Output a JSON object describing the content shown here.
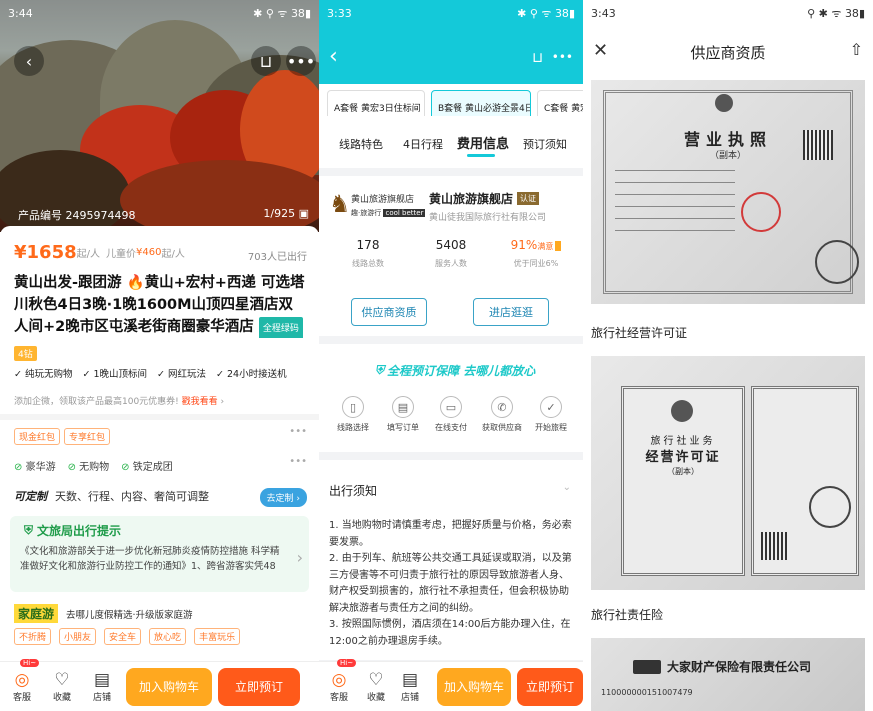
{
  "panel1": {
    "status": {
      "time": "3:44",
      "battery": "38"
    },
    "hero": {
      "product_code": "产品编号 2495974498",
      "counter": "1/925"
    },
    "price": {
      "main": "¥1658",
      "suffix": "起/人",
      "child_label": "儿童价",
      "child_price": "¥460",
      "child_suffix": "起/人",
      "sold": "703人已出行"
    },
    "title": "黄山出发-跟团游 🔥黄山+宏村+西递 可选塔川秋色4日3晚·1晚1600M山顶四星酒店双人间+2晚市区屯溪老街商圈豪华酒店",
    "title_badge": "全程绿码",
    "tag_badge": "4钻",
    "features": [
      "纯玩无购物",
      "1晚山顶标间",
      "网红玩法",
      "24小时接送机"
    ],
    "promo": {
      "text": "添加企微，领取该产品最高100元优惠券!",
      "link": "戳我看看"
    },
    "coupons": [
      "现金红包",
      "专享红包"
    ],
    "guarantees": [
      "豪华游",
      "无购物",
      "铁定成团"
    ],
    "custom": {
      "logo": "可定制",
      "text": "天数、行程、内容、奢简可调整",
      "button": "去定制"
    },
    "notice": {
      "title": "文旅局出行提示",
      "body": "《文化和旅游部关于进一步优化新冠肺炎疫情防控措施 科学精准做好文化和旅游行业防控工作的通知》1、跨省游客实凭48小..."
    },
    "family": {
      "logo": "家庭游",
      "text": "去哪儿度假精选·升级版家庭游",
      "tags": [
        "不折腾",
        "小朋友",
        "安全车",
        "放心吃",
        "丰富玩乐"
      ]
    },
    "bottom": {
      "badge": "Hi~",
      "icons": [
        "客服",
        "收藏",
        "店铺"
      ],
      "cart": "加入购物车",
      "buy": "立即预订"
    }
  },
  "panel2": {
    "status": {
      "time": "3:33",
      "battery": "38"
    },
    "packages": [
      "A套餐 黄宏3日住标间",
      "B套餐 黄山必游全景4日",
      "C套餐 黄宏"
    ],
    "tabs": [
      "线路特色",
      "4日行程",
      "费用信息",
      "预订须知"
    ],
    "active_tab": "费用信息",
    "shop": {
      "logo_name": "黄山旅游旗舰店",
      "logo_sub1": "趣·旅游行",
      "logo_sub2": "cool better",
      "name": "黄山旅游旗舰店",
      "badge": "认证",
      "company": "黄山徒我国际旅行社有限公司"
    },
    "stats": [
      {
        "value": "178",
        "label": "线路总数"
      },
      {
        "value": "5408",
        "label": "服务人数"
      },
      {
        "value": "91%",
        "extra": "满意",
        "label": "优于同业6%"
      }
    ],
    "buttons": {
      "qual": "供应商资质",
      "shop": "进店逛逛"
    },
    "guarantee": "全程预订保障 去哪儿都放心",
    "steps": [
      "线路选择",
      "填写订单",
      "在线支付",
      "获取供应商",
      "开始旅程"
    ],
    "notice": {
      "title": "出行须知",
      "items": [
        "1. 当地购物时请慎重考虑，把握好质量与价格，务必索要发票。",
        "2. 由于列车、航班等公共交通工具延误或取消，以及第三方侵害等不可归责于旅行社的原因导致旅游者人身、财产权受到损害的，旅行社不承担责任，但会积极协助解决旅游者与责任方之间的纠纷。",
        "3. 按照国际惯例，酒店须在14:00后方能办理入住，在12:00之前办理退房手续。"
      ]
    },
    "bottom": {
      "badge": "Hi~",
      "icons": [
        "客服",
        "收藏",
        "店铺"
      ],
      "cart": "加入购物车",
      "buy": "立即预订"
    }
  },
  "panel3": {
    "status": {
      "time": "3:43",
      "battery": "38"
    },
    "title": "供应商资质",
    "doc1": {
      "title": "营业执照",
      "sub": "（副本）"
    },
    "section2": "旅行社经营许可证",
    "doc2": {
      "title_top": "旅行社业务",
      "title": "经营许可证",
      "sub": "（副本）"
    },
    "section3": "旅行社责任险",
    "doc3": {
      "company": "大家财产保险有限责任公司",
      "number": "110000000151007479"
    }
  },
  "colors": {
    "orange": "#ff6a1a",
    "teal": "#14c9d9",
    "blue": "#1e86b3",
    "green": "#27b34a"
  }
}
